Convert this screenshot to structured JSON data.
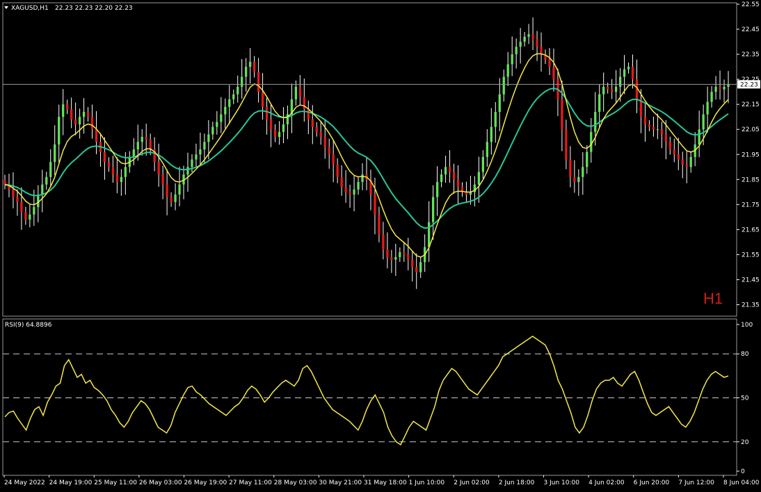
{
  "header": {
    "symbol": "XAGUSD,H1",
    "ohlc": "22.23 22.23 22.20 22.23",
    "timeframe_badge": "H1",
    "price_tag": "22.23"
  },
  "colors": {
    "background": "#000000",
    "bull": "#61e35a",
    "bear": "#e21b1b",
    "wick": "#ffffff",
    "ma_fast": "#f4e94a",
    "ma_slow": "#27c79a",
    "rsi_line": "#f4e94a",
    "level_line": "#ffffff",
    "axis_text": "#ffffff",
    "timeframe_text": "#d21b1b"
  },
  "chart_data": [
    {
      "type": "candlestick",
      "title": "XAGUSD,H1",
      "ylim": [
        21.3,
        22.6
      ],
      "y_ticks": [
        "22.55",
        "22.45",
        "22.35",
        "22.25",
        "22.15",
        "22.05",
        "21.95",
        "21.85",
        "21.75",
        "21.65",
        "21.55",
        "21.45",
        "21.35"
      ],
      "x_ticks": [
        "24 May 2022",
        "24 May 19:00",
        "25 May 11:00",
        "26 May 03:00",
        "26 May 19:00",
        "27 May 11:00",
        "28 May 03:00",
        "30 May 21:00",
        "31 May 18:00",
        "1 Jun 10:00",
        "2 Jun 02:00",
        "2 Jun 18:00",
        "3 Jun 10:00",
        "4 Jun 02:00",
        "6 Jun 20:00",
        "7 Jun 12:00",
        "8 Jun 04:00"
      ],
      "last_price": 22.23,
      "close": [
        21.83,
        21.81,
        21.78,
        21.76,
        21.72,
        21.69,
        21.71,
        21.74,
        21.79,
        21.83,
        21.86,
        21.92,
        21.99,
        22.1,
        22.15,
        22.13,
        22.09,
        22.07,
        22.1,
        22.12,
        22.1,
        22.05,
        22.0,
        21.96,
        21.92,
        21.9,
        21.87,
        21.84,
        21.86,
        21.9,
        21.94,
        21.97,
        22.0,
        22.02,
        22.01,
        21.97,
        21.92,
        21.87,
        21.83,
        21.78,
        21.76,
        21.79,
        21.83,
        21.87,
        21.9,
        21.93,
        21.95,
        21.97,
        22.0,
        22.03,
        22.06,
        22.08,
        22.11,
        22.14,
        22.17,
        22.19,
        22.22,
        22.26,
        22.3,
        22.32,
        22.28,
        22.2,
        22.14,
        22.09,
        22.05,
        22.02,
        22.04,
        22.07,
        22.11,
        22.17,
        22.22,
        22.18,
        22.13,
        22.09,
        22.06,
        22.04,
        22.02,
        21.98,
        21.95,
        21.91,
        21.86,
        21.82,
        21.8,
        21.79,
        21.81,
        21.84,
        21.87,
        21.85,
        21.79,
        21.71,
        21.63,
        21.57,
        21.54,
        21.53,
        21.54,
        21.56,
        21.55,
        21.53,
        21.5,
        21.48,
        21.52,
        21.58,
        21.68,
        21.78,
        21.84,
        21.87,
        21.9,
        21.88,
        21.85,
        21.82,
        21.8,
        21.79,
        21.8,
        21.83,
        21.88,
        21.94,
        22.0,
        22.06,
        22.12,
        22.19,
        22.26,
        22.31,
        22.35,
        22.38,
        22.4,
        22.42,
        22.43,
        22.41,
        22.38,
        22.35,
        22.33,
        22.3,
        22.25,
        22.17,
        22.05,
        21.93,
        21.86,
        21.84,
        21.86,
        21.9,
        21.96,
        22.04,
        22.12,
        22.19,
        22.22,
        22.21,
        22.2,
        22.22,
        22.26,
        22.29,
        22.3,
        22.25,
        22.17,
        22.1,
        22.07,
        22.06,
        22.05,
        22.05,
        22.03,
        22.0,
        21.97,
        21.95,
        21.93,
        21.91,
        21.9,
        21.94,
        21.99,
        22.05,
        22.11,
        22.16,
        22.2,
        22.22,
        22.21,
        22.22,
        22.23
      ]
    },
    {
      "type": "line",
      "title": "RSI(9) 64.8896",
      "ylim": [
        0,
        100
      ],
      "y_ticks": [
        100,
        80,
        50,
        20,
        0
      ],
      "levels": [
        80,
        50,
        20
      ],
      "values": [
        37,
        40,
        41,
        36,
        32,
        28,
        36,
        42,
        44,
        38,
        47,
        52,
        58,
        60,
        72,
        76,
        70,
        64,
        66,
        60,
        62,
        57,
        55,
        52,
        48,
        42,
        38,
        33,
        30,
        34,
        40,
        44,
        48,
        46,
        42,
        36,
        30,
        28,
        26,
        31,
        40,
        46,
        52,
        57,
        58,
        54,
        52,
        49,
        46,
        44,
        42,
        40,
        38,
        41,
        44,
        46,
        50,
        55,
        58,
        56,
        52,
        47,
        50,
        54,
        57,
        60,
        62,
        60,
        58,
        62,
        70,
        72,
        68,
        62,
        56,
        50,
        46,
        42,
        40,
        38,
        36,
        34,
        31,
        28,
        34,
        42,
        48,
        52,
        46,
        40,
        30,
        24,
        20,
        18,
        24,
        30,
        34,
        32,
        30,
        28,
        36,
        44,
        55,
        62,
        66,
        70,
        68,
        64,
        60,
        56,
        54,
        52,
        56,
        60,
        64,
        68,
        72,
        78,
        80,
        82,
        84,
        86,
        88,
        90,
        92,
        90,
        88,
        86,
        80,
        72,
        62,
        56,
        48,
        40,
        30,
        26,
        30,
        38,
        48,
        56,
        60,
        62,
        62,
        64,
        60,
        58,
        62,
        66,
        68,
        62,
        54,
        46,
        40,
        38,
        40,
        42,
        44,
        40,
        36,
        32,
        30,
        34,
        40,
        48,
        56,
        62,
        66,
        68,
        66,
        64,
        65
      ]
    }
  ]
}
